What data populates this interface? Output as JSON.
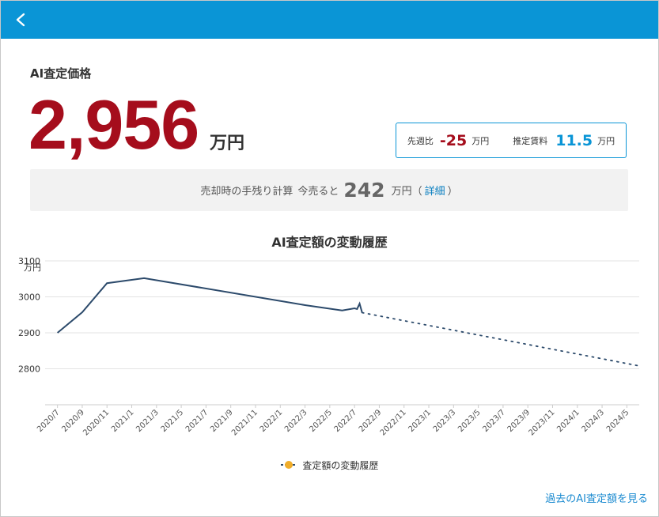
{
  "header": {
    "back_icon": "chevron-left-icon",
    "bar_color": "#0a95d6"
  },
  "valuation": {
    "label": "AI査定価格",
    "price": "2,956",
    "unit": "万円",
    "price_color": "#a50d1c"
  },
  "summary_box": {
    "week_label": "先週比",
    "week_change": "-25",
    "week_unit": "万円",
    "fee_label": "推定賃料",
    "fee_value": "11.5",
    "fee_unit": "万円"
  },
  "calc": {
    "text": "売却時の手残り計算",
    "sell_now": "今売ると",
    "amount": "242",
    "unit": "万円",
    "paren_open": "（",
    "detail_link": "詳細",
    "paren_close": "）"
  },
  "chart_title": "AI査定額の変動履歴",
  "chart_data": {
    "type": "line",
    "ylabel": "万円",
    "ylim": [
      2700,
      3100
    ],
    "yticks": [
      2800,
      2900,
      3000,
      3100
    ],
    "x_ticks": [
      "2020/7",
      "2020/9",
      "2020/11",
      "2021/1",
      "2021/3",
      "2021/5",
      "2021/7",
      "2021/9",
      "2021/11",
      "2022/1",
      "2022/3",
      "2022/5",
      "2022/7",
      "2022/9",
      "2022/11",
      "2023/1",
      "2023/3",
      "2023/5",
      "2023/7",
      "2023/9",
      "2023/11",
      "2024/1",
      "2024/3",
      "2024/5"
    ],
    "series": [
      {
        "name": "査定額の変動履歴",
        "style": "solid",
        "color": "#2c4a6b",
        "points": [
          {
            "x": "2020/7",
            "y": 2900
          },
          {
            "x": "2020/9",
            "y": 2957
          },
          {
            "x": "2020/11",
            "y": 3038
          },
          {
            "x": "2021/2",
            "y": 3052
          },
          {
            "x": "2022/3",
            "y": 2977
          },
          {
            "x": "2022/6",
            "y": 2962
          },
          {
            "x": "2022/7",
            "y": 2968
          },
          {
            "x": "2022/7",
            "y": 2966
          },
          {
            "x": "2022/7",
            "y": 2981
          },
          {
            "x": "2022/7",
            "y": 2956
          }
        ]
      },
      {
        "name": "",
        "style": "dotted",
        "color": "#2c4a6b",
        "points": [
          {
            "x": "2022/7",
            "y": 2956
          },
          {
            "x": "2024/6",
            "y": 2808
          }
        ]
      }
    ],
    "legend_marker_color": "#f0ad2a",
    "legend_position": "bottom",
    "grid": true
  },
  "history_link": "過去のAI査定額を見る"
}
